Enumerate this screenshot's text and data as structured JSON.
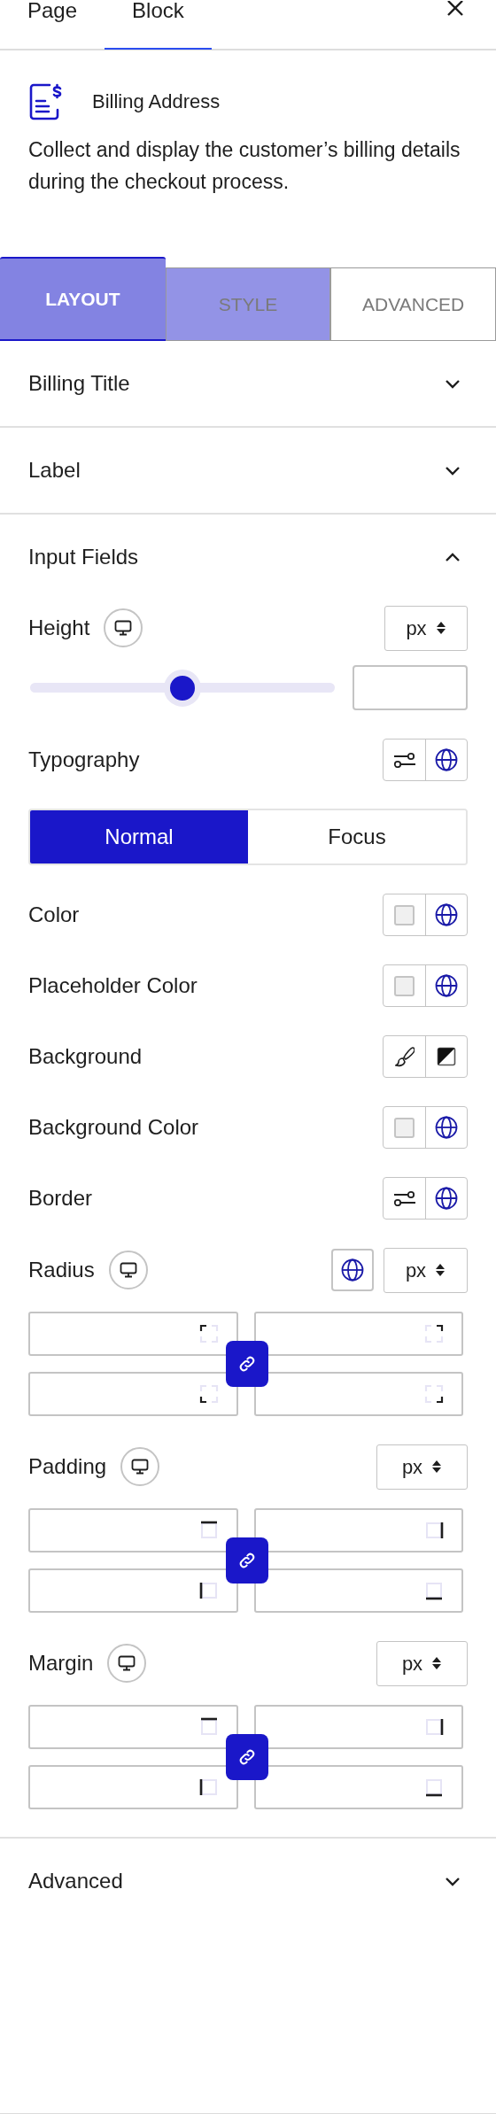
{
  "top_tabs": [
    {
      "label": "Page",
      "selected": false
    },
    {
      "label": "Block",
      "selected": true
    }
  ],
  "block": {
    "title": "Billing Address",
    "description": "Collect and display the customer’s billing details during the checkout process."
  },
  "panel_tabs": [
    {
      "label": "LAYOUT",
      "selected": true,
      "hovered": false
    },
    {
      "label": "STYLE",
      "selected": false,
      "hovered": true
    },
    {
      "label": "ADVANCED",
      "selected": false,
      "hovered": false
    }
  ],
  "sections": [
    {
      "title": "Billing Title",
      "expanded": false
    },
    {
      "title": "Label",
      "expanded": false
    },
    {
      "title": "Input Fields",
      "expanded": true,
      "controls": [
        {
          "kind": "slider",
          "label": "Height",
          "responsive": true,
          "unit": "px",
          "level": 0.5
        },
        {
          "kind": "popover",
          "label": "Typography"
        },
        {
          "kind": "toggle",
          "options": [
            {
              "label": "Normal",
              "selected": true
            },
            {
              "label": "Focus",
              "selected": false
            }
          ]
        },
        {
          "kind": "color",
          "label": "Color"
        },
        {
          "kind": "color",
          "label": "Placeholder Color"
        },
        {
          "kind": "background",
          "label": "Background"
        },
        {
          "kind": "color",
          "label": "Background Color"
        },
        {
          "kind": "popover",
          "label": "Border"
        },
        {
          "kind": "radius",
          "label": "Radius",
          "responsive": true,
          "global_button": true,
          "unit": "px"
        },
        {
          "kind": "spacing",
          "label": "Padding",
          "responsive": true,
          "global_button": false,
          "unit": "px"
        },
        {
          "kind": "spacing",
          "label": "Margin",
          "responsive": true,
          "global_button": false,
          "unit": "px"
        }
      ]
    },
    {
      "title": "Advanced",
      "expanded": false
    }
  ]
}
